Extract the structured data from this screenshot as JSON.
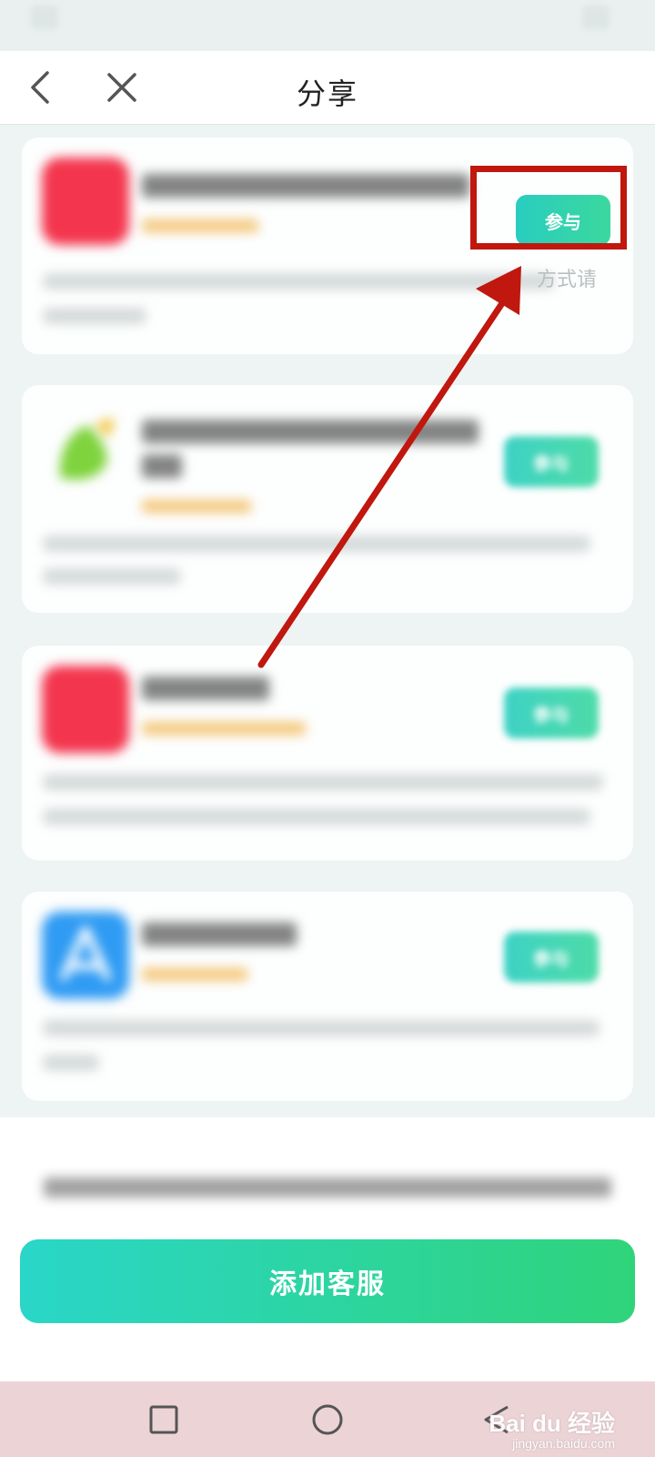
{
  "header": {
    "title": "分享"
  },
  "tasks": [
    {
      "join_label": "参与",
      "partial_desc": "方式请"
    },
    {
      "join_label": "参与"
    },
    {
      "join_label": "参与"
    },
    {
      "join_label": "参与"
    }
  ],
  "footer": {
    "add_service_label": "添加客服"
  },
  "watermark": {
    "brand": "Bai du 经验",
    "url": "jingyan.baidu.com"
  },
  "colors": {
    "accent": "#2ed3a8",
    "annotation": "#c0170f"
  }
}
